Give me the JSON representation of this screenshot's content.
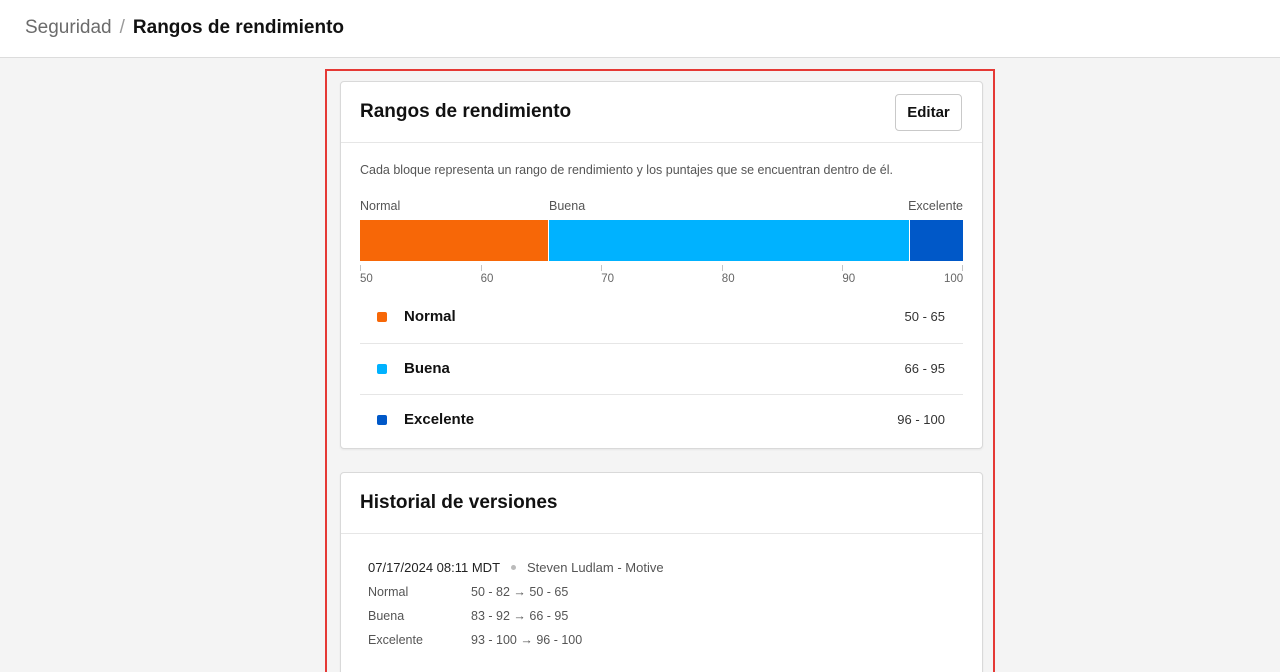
{
  "breadcrumb": {
    "parent": "Seguridad",
    "separator": "/",
    "current": "Rangos de rendimiento"
  },
  "ranges_card": {
    "title": "Rangos de rendimiento",
    "edit_label": "Editar",
    "description": "Cada bloque representa un rango de rendimiento y los puntajes que se encuentran dentro de él.",
    "bar_labels": [
      "Normal",
      "Buena",
      "Excelente"
    ],
    "axis_ticks": [
      "50",
      "60",
      "70",
      "80",
      "90",
      "100"
    ],
    "legend": [
      {
        "name": "Normal",
        "range": "50 - 65",
        "color": "#f76707"
      },
      {
        "name": "Buena",
        "range": "66 - 95",
        "color": "#00b2ff"
      },
      {
        "name": "Excelente",
        "range": "96 - 100",
        "color": "#0058c8"
      }
    ]
  },
  "chart_data": {
    "type": "bar",
    "orientation": "horizontal-stacked",
    "xlim": [
      50,
      100
    ],
    "segments": [
      {
        "name": "Normal",
        "start": 50,
        "end": 65.6,
        "color": "#f76707"
      },
      {
        "name": "Buena",
        "start": 65.6,
        "end": 95.5,
        "color": "#00b2ff"
      },
      {
        "name": "Excelente",
        "start": 95.5,
        "end": 100,
        "color": "#0058c8"
      }
    ],
    "ticks": [
      50,
      60,
      70,
      80,
      90,
      100
    ]
  },
  "history_card": {
    "title": "Historial de versiones",
    "entries": [
      {
        "date": "07/17/2024 08:11 MDT",
        "author": "Steven Ludlam - Motive",
        "changes": [
          {
            "label": "Normal",
            "change": "50 - 82 → 50 - 65"
          },
          {
            "label": "Buena",
            "change": "83 - 92 → 66 - 95"
          },
          {
            "label": "Excelente",
            "change": "93 - 100 → 96 - 100"
          }
        ]
      }
    ]
  }
}
